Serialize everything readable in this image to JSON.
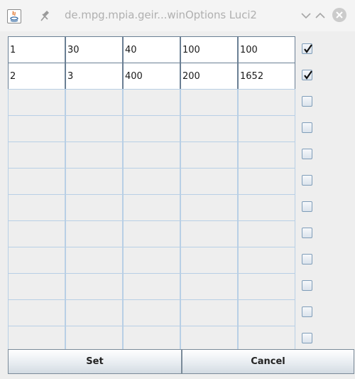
{
  "window": {
    "title": "de.mpg.mpia.geir...winOptions Luci2",
    "icons": [
      "java-icon",
      "pin-icon",
      "minimize-chevron-icon",
      "maximize-chevron-icon",
      "close-icon"
    ]
  },
  "table": {
    "rows": [
      {
        "cells": [
          "1",
          "30",
          "40",
          "100",
          "100"
        ],
        "checked": true
      },
      {
        "cells": [
          "2",
          "3",
          "400",
          "200",
          "1652"
        ],
        "checked": true
      },
      {
        "cells": [
          "",
          "",
          "",
          "",
          ""
        ],
        "checked": false
      },
      {
        "cells": [
          "",
          "",
          "",
          "",
          ""
        ],
        "checked": false
      },
      {
        "cells": [
          "",
          "",
          "",
          "",
          ""
        ],
        "checked": false
      },
      {
        "cells": [
          "",
          "",
          "",
          "",
          ""
        ],
        "checked": false
      },
      {
        "cells": [
          "",
          "",
          "",
          "",
          ""
        ],
        "checked": false
      },
      {
        "cells": [
          "",
          "",
          "",
          "",
          ""
        ],
        "checked": false
      },
      {
        "cells": [
          "",
          "",
          "",
          "",
          ""
        ],
        "checked": false
      },
      {
        "cells": [
          "",
          "",
          "",
          "",
          ""
        ],
        "checked": false
      },
      {
        "cells": [
          "",
          "",
          "",
          "",
          ""
        ],
        "checked": false
      },
      {
        "cells": [
          "",
          "",
          "",
          "",
          ""
        ],
        "checked": false
      }
    ]
  },
  "buttons": {
    "set_label": "Set",
    "cancel_label": "Cancel"
  },
  "colors": {
    "filled_border": "#6a7f94",
    "empty_border": "#b8cfe5",
    "background": "#eeeeee"
  }
}
